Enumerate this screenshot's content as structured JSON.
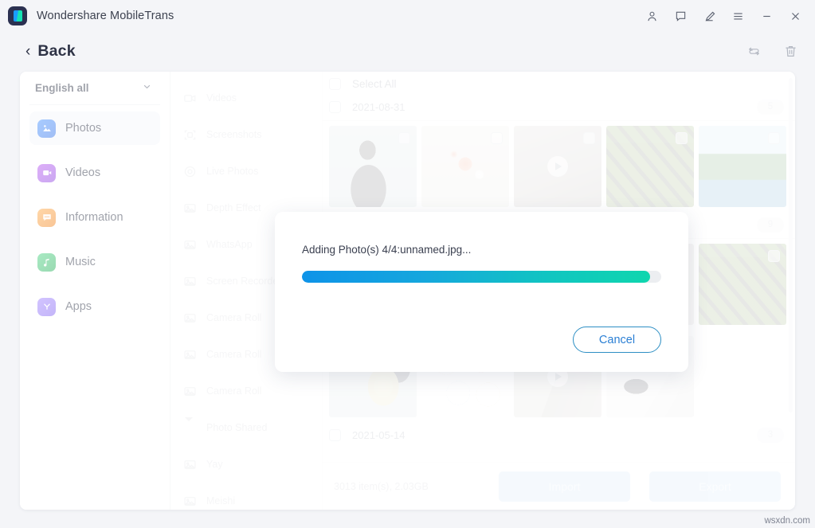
{
  "window": {
    "title": "Wondershare MobileTrans",
    "logo_icon": "app-logo-icon",
    "controls": [
      {
        "name": "account-icon",
        "label": "Account"
      },
      {
        "name": "feedback-icon",
        "label": "Feedback"
      },
      {
        "name": "edit-icon",
        "label": "Edit"
      },
      {
        "name": "menu-icon",
        "label": "Menu"
      },
      {
        "name": "minimize-icon",
        "label": "Minimize"
      },
      {
        "name": "close-icon",
        "label": "Close"
      }
    ]
  },
  "subheader": {
    "back_label": "Back",
    "back_chevron": "‹",
    "actions": [
      {
        "name": "refresh-icon",
        "label": "Refresh"
      },
      {
        "name": "delete-icon",
        "label": "Delete"
      }
    ]
  },
  "sidebar": {
    "language": {
      "value": "English all",
      "caret": "⌄"
    },
    "items": [
      {
        "label": "Photos",
        "icon": "photos-icon",
        "active": true
      },
      {
        "label": "Videos",
        "icon": "videos-icon",
        "active": false
      },
      {
        "label": "Information",
        "icon": "information-icon",
        "active": false
      },
      {
        "label": "Music",
        "icon": "music-icon",
        "active": false
      },
      {
        "label": "Apps",
        "icon": "apps-icon",
        "active": false
      }
    ]
  },
  "albums": [
    {
      "label": "Videos",
      "icon": "video-camera-icon",
      "type": "item"
    },
    {
      "label": "Screenshots",
      "icon": "screenshot-icon",
      "type": "item"
    },
    {
      "label": "Live Photos",
      "icon": "live-photo-icon",
      "type": "item"
    },
    {
      "label": "Depth Effect",
      "icon": "album-icon",
      "type": "item"
    },
    {
      "label": "WhatsApp",
      "icon": "album-icon",
      "type": "item"
    },
    {
      "label": "Screen Recorder",
      "icon": "album-icon",
      "type": "item"
    },
    {
      "label": "Camera Roll",
      "icon": "album-icon",
      "type": "item"
    },
    {
      "label": "Camera Roll",
      "icon": "album-icon",
      "type": "item"
    },
    {
      "label": "Camera Roll",
      "icon": "album-icon",
      "type": "item"
    },
    {
      "label": "Photo Shared",
      "icon": "triangle-down-icon",
      "type": "group"
    },
    {
      "label": "Yay",
      "icon": "album-icon",
      "type": "item"
    },
    {
      "label": "Meishi",
      "icon": "album-icon",
      "type": "item"
    }
  ],
  "grid": {
    "select_all_label": "Select All",
    "groups": [
      {
        "date": "2021-08-31",
        "count": "5"
      },
      {
        "date": "",
        "count": "9"
      },
      {
        "date": "2021-05-14",
        "count": "3"
      }
    ],
    "rows": [
      [
        {
          "name": "thumb-person",
          "style": "t-person",
          "video": false
        },
        {
          "name": "thumb-flowers",
          "style": "t-flowers",
          "video": false
        },
        {
          "name": "thumb-video-clip",
          "style": "t-video",
          "video": true
        },
        {
          "name": "thumb-bricks",
          "style": "t-bricks",
          "video": false
        },
        {
          "name": "thumb-palm-beach",
          "style": "t-palm",
          "video": false
        }
      ],
      [
        {
          "name": "thumb-bricks-2",
          "style": "t-bricks2",
          "video": false
        }
      ],
      [
        {
          "name": "thumb-artwork",
          "style": "t-art",
          "video": false
        },
        {
          "name": "thumb-chart",
          "style": "t-chart",
          "video": false
        },
        {
          "name": "thumb-room-video",
          "style": "t-room",
          "video": true
        },
        {
          "name": "thumb-cable",
          "style": "t-cable",
          "video": false
        }
      ]
    ]
  },
  "bottombar": {
    "stats": "3013 item(s), 2.03GB",
    "import_label": "Import",
    "export_label": "Export"
  },
  "modal": {
    "message": "Adding Photo(s) 4/4:unnamed.jpg...",
    "progress_percent": 97,
    "cancel_label": "Cancel"
  },
  "watermark": "wsxdn.com",
  "colors": {
    "accent_blue": "#2b7fd4",
    "progress_start": "#0e93e8",
    "progress_end": "#0fd6ae",
    "button_disabled": "#b4d4f2",
    "page_bg": "#f4f5f8"
  }
}
